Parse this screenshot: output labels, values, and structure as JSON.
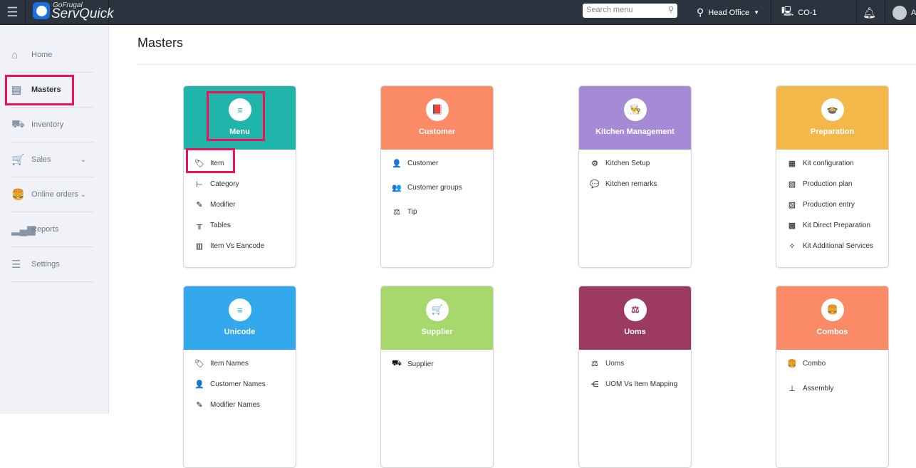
{
  "topbar": {
    "logo_small": "GoFrugal",
    "logo_main": "ServQuick",
    "search_placeholder": "Search menu",
    "location": "Head Office",
    "counter": "CO-1",
    "user_initial": "A"
  },
  "sidebar": {
    "items": [
      {
        "label": "Home",
        "icon": "⌂"
      },
      {
        "label": "Masters",
        "icon": "▤"
      },
      {
        "label": "Inventory",
        "icon": "⛟"
      },
      {
        "label": "Sales",
        "icon": "🛒"
      },
      {
        "label": "Online orders",
        "icon": "🍔"
      },
      {
        "label": "Reports",
        "icon": "▂▄▆"
      },
      {
        "label": "Settings",
        "icon": "☰"
      }
    ]
  },
  "page": {
    "title": "Masters"
  },
  "cards": [
    {
      "title": "Menu",
      "color": "#20b5aa",
      "icon": "≡",
      "items": [
        {
          "label": "Item",
          "icon": "🏷"
        },
        {
          "label": "Category",
          "icon": "⊢"
        },
        {
          "label": "Modifier",
          "icon": "✎"
        },
        {
          "label": "Tables",
          "icon": "╥"
        },
        {
          "label": "Item Vs Eancode",
          "icon": "▥"
        }
      ]
    },
    {
      "title": "Customer",
      "color": "#fb8a66",
      "icon": "📕",
      "items": [
        {
          "label": "Customer",
          "icon": "👤"
        },
        {
          "label": "Customer groups",
          "icon": "👥"
        },
        {
          "label": "Tip",
          "icon": "⚖"
        }
      ]
    },
    {
      "title": "Kitchen Management",
      "color": "#a78ad6",
      "icon": "👨‍🍳",
      "items": [
        {
          "label": "Kitchen Setup",
          "icon": "⚙"
        },
        {
          "label": "Kitchen remarks",
          "icon": "💬"
        }
      ]
    },
    {
      "title": "Preparation",
      "color": "#f4b74a",
      "icon": "🍲",
      "items": [
        {
          "label": "Kit configuration",
          "icon": "▦"
        },
        {
          "label": "Production plan",
          "icon": "▧"
        },
        {
          "label": "Production entry",
          "icon": "▨"
        },
        {
          "label": "Kit Direct Preparation",
          "icon": "▩"
        },
        {
          "label": "Kit Additional Services",
          "icon": "✧"
        }
      ]
    },
    {
      "title": "Unicode",
      "color": "#33a8ec",
      "icon": "≡",
      "items": [
        {
          "label": "Item Names",
          "icon": "🏷"
        },
        {
          "label": "Customer Names",
          "icon": "👤"
        },
        {
          "label": "Modifier Names",
          "icon": "✎"
        }
      ]
    },
    {
      "title": "Supplier",
      "color": "#a6d86e",
      "icon": "🛒",
      "items": [
        {
          "label": "Supplier",
          "icon": "⛟"
        }
      ]
    },
    {
      "title": "Uoms",
      "color": "#9d3a62",
      "icon": "⚖",
      "items": [
        {
          "label": "Uoms",
          "icon": "⚖"
        },
        {
          "label": "UOM Vs Item Mapping",
          "icon": "⋲"
        }
      ]
    },
    {
      "title": "Combos",
      "color": "#fb8a66",
      "icon": "🍔",
      "items": [
        {
          "label": "Combo",
          "icon": "🍔"
        },
        {
          "label": "Assembly",
          "icon": "⊥"
        }
      ]
    }
  ]
}
